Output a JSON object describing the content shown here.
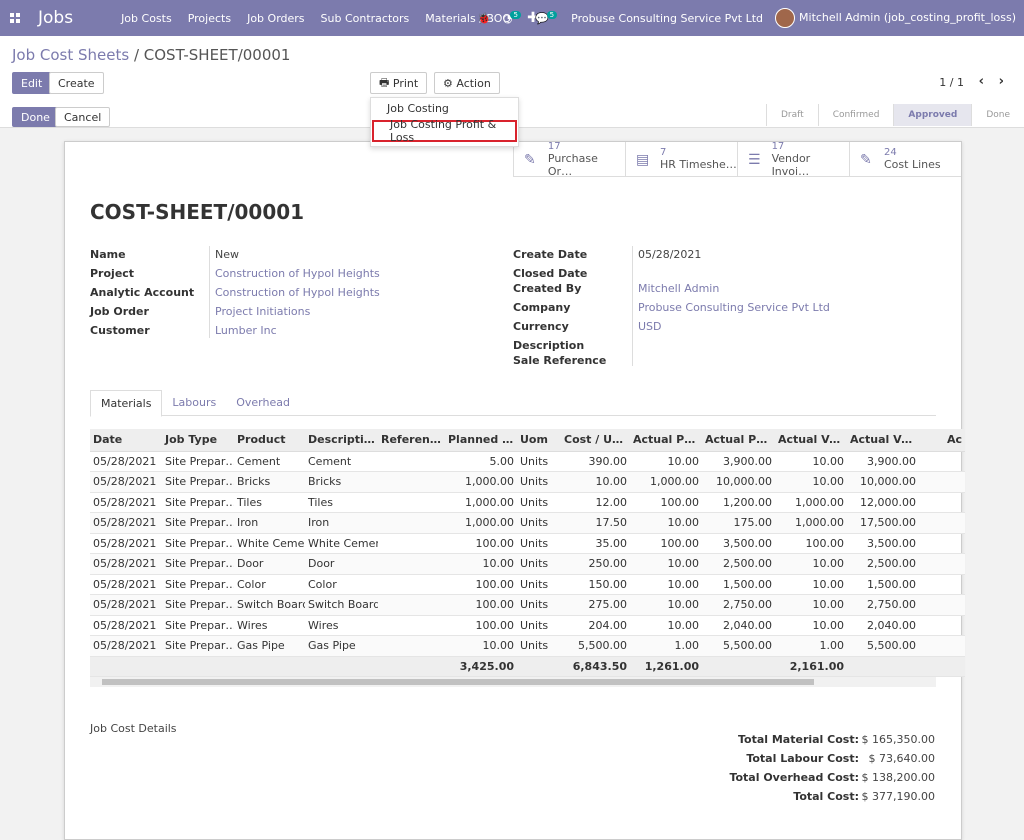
{
  "app": {
    "title": "Jobs"
  },
  "menu": [
    "Job Costs",
    "Projects",
    "Job Orders",
    "Sub Contractors",
    "Materials / BOQ"
  ],
  "nav_right": {
    "activity_count": "5",
    "message_count": "5",
    "company": "Probuse Consulting Service Pvt Ltd",
    "user": "Mitchell Admin (job_costing_profit_loss)"
  },
  "breadcrumb": {
    "parent": "Job Cost Sheets",
    "separator": " / ",
    "current": "COST-SHEET/00001"
  },
  "buttons": {
    "edit": "Edit",
    "create": "Create",
    "print": "Print",
    "action": "Action",
    "done": "Done",
    "cancel": "Cancel"
  },
  "pager": "1 / 1",
  "status": [
    "Draft",
    "Confirmed",
    "Approved",
    "Done"
  ],
  "active_status": "Approved",
  "print_menu": [
    "Job Costing",
    "Job Costing Profit & Loss"
  ],
  "smart_buttons": [
    {
      "count": "17",
      "label": "Purchase Or…",
      "icon": "edit-icon"
    },
    {
      "count": "7",
      "label": "HR Timeshe…",
      "icon": "book-icon"
    },
    {
      "count": "17",
      "label": "Vendor Invoi…",
      "icon": "list-icon"
    },
    {
      "count": "24",
      "label": "Cost Lines",
      "icon": "edit-icon"
    }
  ],
  "record": {
    "title": "COST-SHEET/00001",
    "left": [
      {
        "label": "Name",
        "value": "New"
      },
      {
        "label": "Project",
        "value": "Construction of Hypol Heights"
      },
      {
        "label": "Analytic Account",
        "value": "Construction of Hypol Heights"
      },
      {
        "label": "Job Order",
        "value": "Project Initiations"
      },
      {
        "label": "Customer",
        "value": "Lumber Inc"
      }
    ],
    "right": [
      {
        "label": "Create Date",
        "value": "05/28/2021"
      },
      {
        "label": "Closed Date",
        "value": ""
      },
      {
        "label": "Created By",
        "value": "Mitchell Admin"
      },
      {
        "label": "Company",
        "value": "Probuse Consulting Service Pvt Ltd"
      },
      {
        "label": "Currency",
        "value": "USD"
      },
      {
        "label": "Description",
        "value": ""
      },
      {
        "label": "Sale Reference",
        "value": ""
      }
    ]
  },
  "tabs": [
    "Materials",
    "Labours",
    "Overhead"
  ],
  "table": {
    "headers": [
      "Date",
      "Job Type",
      "Product",
      "Descriptio…",
      "Reference",
      "Planned Qt…",
      "Uom",
      "Cost / Unit",
      "Actual Pur…",
      "Actual Pur…",
      "Actual Ven…",
      "Actual Ven…",
      "Ac"
    ],
    "rows": [
      [
        "05/28/2021",
        "Site Prepar…",
        "Cement",
        "Cement",
        "",
        "5.00",
        "Units",
        "390.00",
        "10.00",
        "3,900.00",
        "10.00",
        "3,900.00"
      ],
      [
        "05/28/2021",
        "Site Prepar…",
        "Bricks",
        "Bricks",
        "",
        "1,000.00",
        "Units",
        "10.00",
        "1,000.00",
        "10,000.00",
        "10.00",
        "10,000.00"
      ],
      [
        "05/28/2021",
        "Site Prepar…",
        "Tiles",
        "Tiles",
        "",
        "1,000.00",
        "Units",
        "12.00",
        "100.00",
        "1,200.00",
        "1,000.00",
        "12,000.00"
      ],
      [
        "05/28/2021",
        "Site Prepar…",
        "Iron",
        "Iron",
        "",
        "1,000.00",
        "Units",
        "17.50",
        "10.00",
        "175.00",
        "1,000.00",
        "17,500.00"
      ],
      [
        "05/28/2021",
        "Site Prepar…",
        "White Cement",
        "White Cement",
        "",
        "100.00",
        "Units",
        "35.00",
        "100.00",
        "3,500.00",
        "100.00",
        "3,500.00"
      ],
      [
        "05/28/2021",
        "Site Prepar…",
        "Door",
        "Door",
        "",
        "10.00",
        "Units",
        "250.00",
        "10.00",
        "2,500.00",
        "10.00",
        "2,500.00"
      ],
      [
        "05/28/2021",
        "Site Prepar…",
        "Color",
        "Color",
        "",
        "100.00",
        "Units",
        "150.00",
        "10.00",
        "1,500.00",
        "10.00",
        "1,500.00"
      ],
      [
        "05/28/2021",
        "Site Prepar…",
        "Switch Board",
        "Switch Board",
        "",
        "100.00",
        "Units",
        "275.00",
        "10.00",
        "2,750.00",
        "10.00",
        "2,750.00"
      ],
      [
        "05/28/2021",
        "Site Prepar…",
        "Wires",
        "Wires",
        "",
        "100.00",
        "Units",
        "204.00",
        "10.00",
        "2,040.00",
        "10.00",
        "2,040.00"
      ],
      [
        "05/28/2021",
        "Site Prepar…",
        "Gas Pipe",
        "Gas Pipe",
        "",
        "10.00",
        "Units",
        "5,500.00",
        "1.00",
        "5,500.00",
        "1.00",
        "5,500.00"
      ]
    ],
    "footer": {
      "planned": "3,425.00",
      "cost_unit": "6,843.50",
      "actual_pur": "1,261.00",
      "actual_ven": "2,161.00"
    }
  },
  "details_label": "Job Cost Details",
  "totals": [
    {
      "label": "Total Material Cost:",
      "value": "$ 165,350.00"
    },
    {
      "label": "Total Labour Cost:",
      "value": "$ 73,640.00"
    },
    {
      "label": "Total Overhead Cost:",
      "value": "$ 138,200.00"
    },
    {
      "label": "Total Cost:",
      "value": "$ 377,190.00"
    }
  ]
}
